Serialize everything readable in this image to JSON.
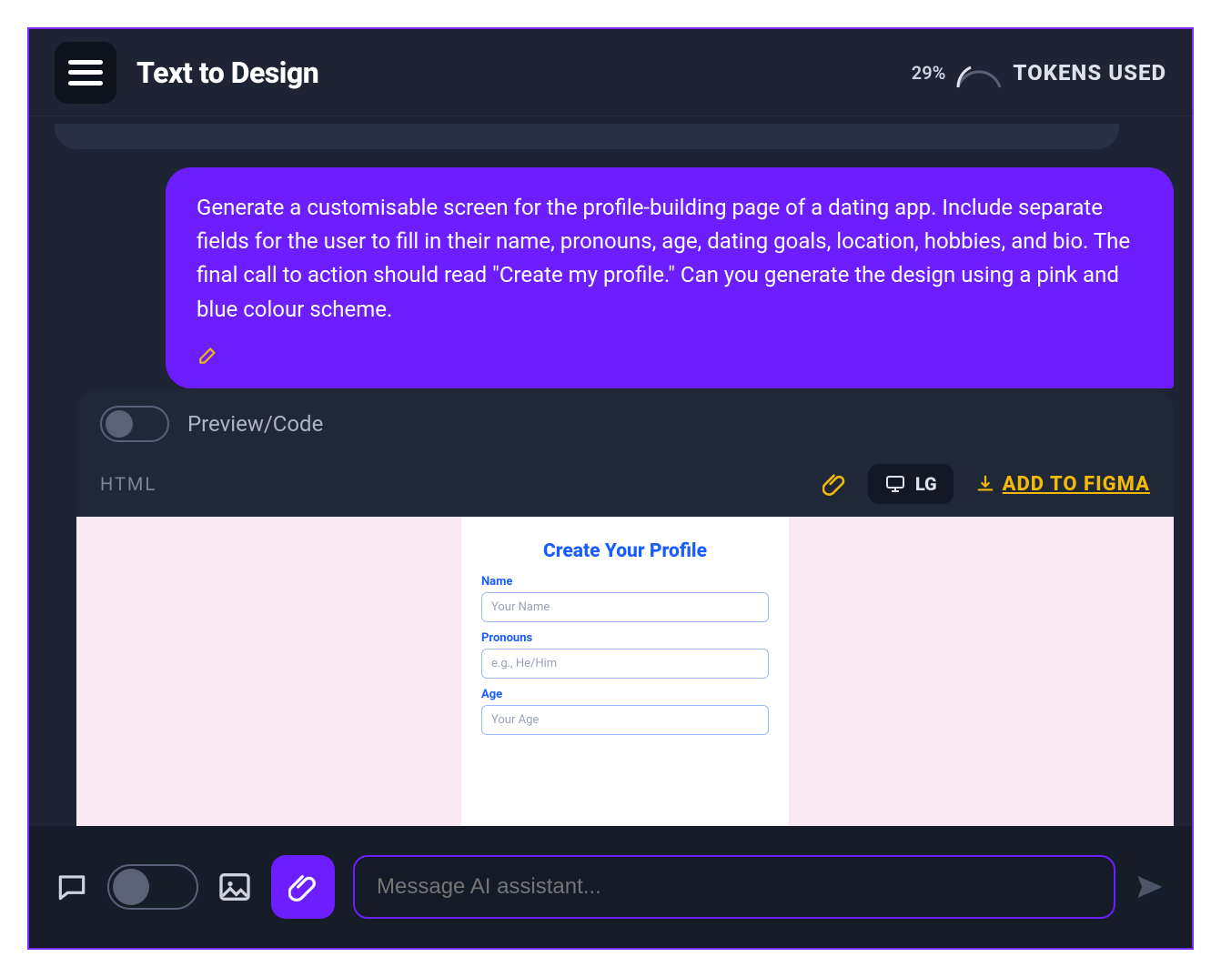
{
  "header": {
    "title": "Text to Design",
    "tokens_pct": "29%",
    "tokens_label": "TOKENS USED"
  },
  "chat": {
    "user_message": "Generate a customisable screen for the profile-building page of a dating app. Include separate fields for the user to fill in their name, pronouns, age, dating goals, location, hobbies, and bio. The final call to action should read \"Create my profile.\" Can you generate the design using a pink and blue colour scheme."
  },
  "panel": {
    "toggle_label": "Preview/Code",
    "html_label": "HTML",
    "size_label": "LG",
    "figma_label": "ADD TO FIGMA"
  },
  "preview_form": {
    "title": "Create Your Profile",
    "fields": [
      {
        "label": "Name",
        "placeholder": "Your Name"
      },
      {
        "label": "Pronouns",
        "placeholder": "e.g., He/Him"
      },
      {
        "label": "Age",
        "placeholder": "Your Age"
      }
    ]
  },
  "bottom": {
    "placeholder": "Message AI assistant..."
  },
  "colors": {
    "purple": "#6c1eff",
    "yellow": "#f0b90b",
    "form_blue": "#1a5cff",
    "preview_bg": "#f9e9f3"
  }
}
